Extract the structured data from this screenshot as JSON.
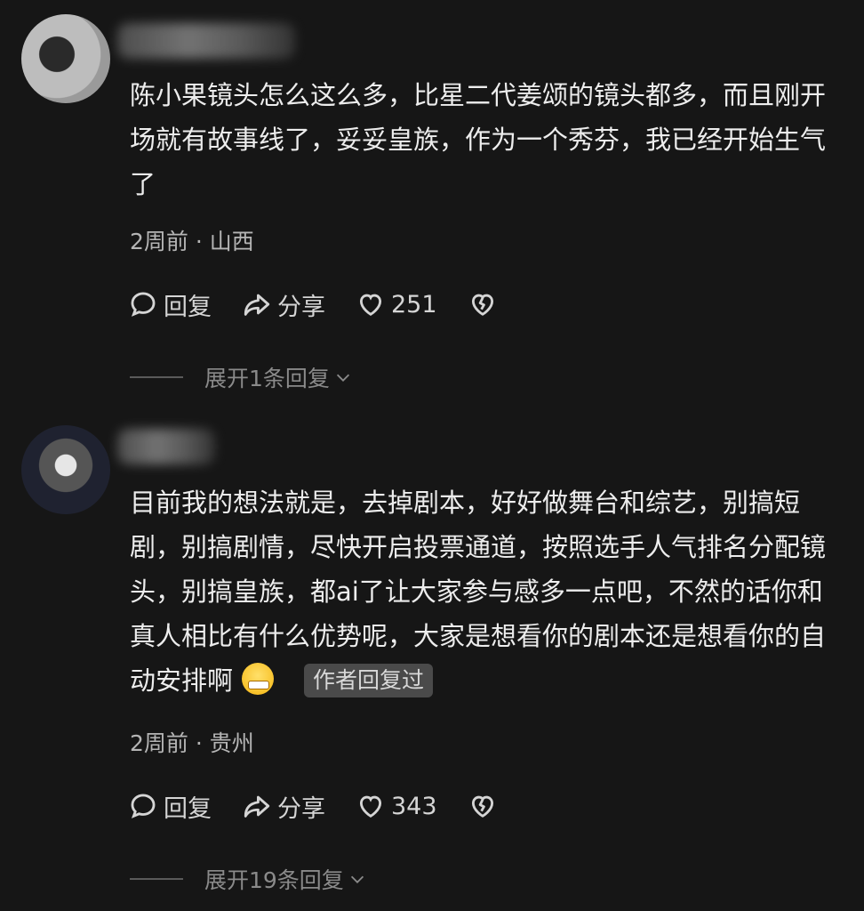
{
  "comments": [
    {
      "text": "陈小果镜头怎么这么多，比星二代姜颂的镜头都多，而且刚开场就有故事线了，妥妥皇族，作为一个秀芬，我已经开始生气了",
      "time_location": "2周前 · 山西",
      "reply_label": "回复",
      "share_label": "分享",
      "likes": "251",
      "expand_label": "展开1条回复"
    },
    {
      "text": "目前我的想法就是，去掉剧本，好好做舞台和综艺，别搞短剧，别搞剧情，尽快开启投票通道，按照选手人气排名分配镜头，别搞皇族，都ai了让大家参与感多一点吧，不然的话你和真人相比有什么优势呢，大家是想看你的剧本还是想看你的自动安排啊",
      "author_badge": "作者回复过",
      "time_location": "2周前 · 贵州",
      "reply_label": "回复",
      "share_label": "分享",
      "likes": "343",
      "expand_label": "展开19条回复"
    }
  ],
  "icons": {
    "reply": "speech-bubble-icon",
    "share": "share-arrow-icon",
    "like": "heart-icon",
    "dislike": "broken-heart-icon",
    "expand": "chevron-down-icon",
    "emoji": "grinning-sweat-emoji-icon"
  }
}
